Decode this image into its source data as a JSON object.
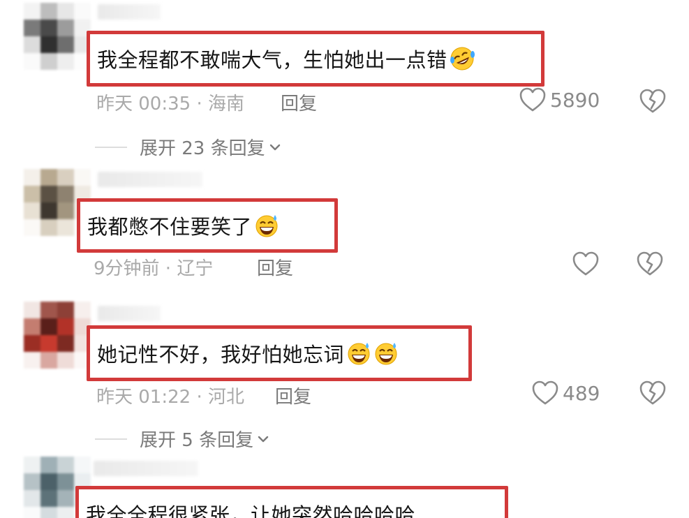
{
  "comments": [
    {
      "text": "我全程都不敢喘大气，生怕她出一点错",
      "emoji": "rolling-on-floor-laughing",
      "meta": "昨天 00:35 · 海南",
      "reply": "回复",
      "likes": "5890",
      "expand": "展开 23 条回复"
    },
    {
      "text": "我都憋不住要笑了",
      "emoji": "grinning-sweat",
      "meta": "9分钟前 · 辽宁",
      "reply": "回复",
      "likes": ""
    },
    {
      "text": "她记性不好，我好怕她忘词",
      "emoji": "grinning-sweat",
      "meta": "昨天 01:22 · 河北",
      "reply": "回复",
      "likes": "489",
      "expand": "展开 5 条回复"
    },
    {
      "text": "我全全程很紧张，让她突然哈哈哈哈"
    }
  ],
  "colors": {
    "highlight_border": "#d23a3a",
    "meta_text": "#a9a9a9",
    "reply_text": "#7a7a7a",
    "like_icon": "#8a8a8a"
  },
  "icons": [
    "heart-outline-icon",
    "broken-heart-icon",
    "chevron-down-icon"
  ]
}
